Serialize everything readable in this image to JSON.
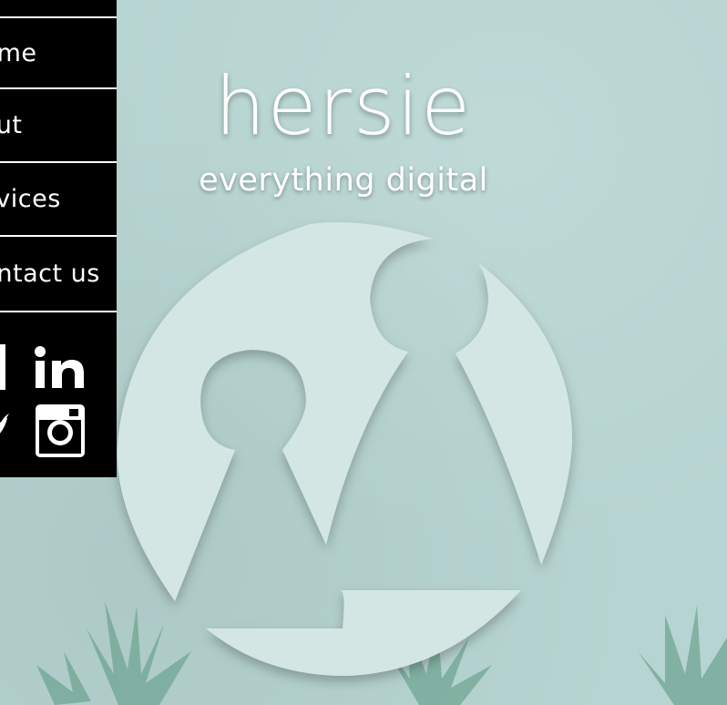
{
  "nav": {
    "items": [
      {
        "label": "home"
      },
      {
        "label": "about"
      },
      {
        "label": "services"
      },
      {
        "label": "contact us"
      }
    ]
  },
  "social": {
    "icons": [
      "facebook-icon",
      "linkedin-icon",
      "twitter-icon",
      "instagram-icon"
    ]
  },
  "hero": {
    "title": "hersie",
    "tagline": "everything digital"
  },
  "colors": {
    "background": "#b6d4d1",
    "sidebar": "#000000",
    "logo": "#d4e6e3",
    "plant": "#6fa592"
  }
}
